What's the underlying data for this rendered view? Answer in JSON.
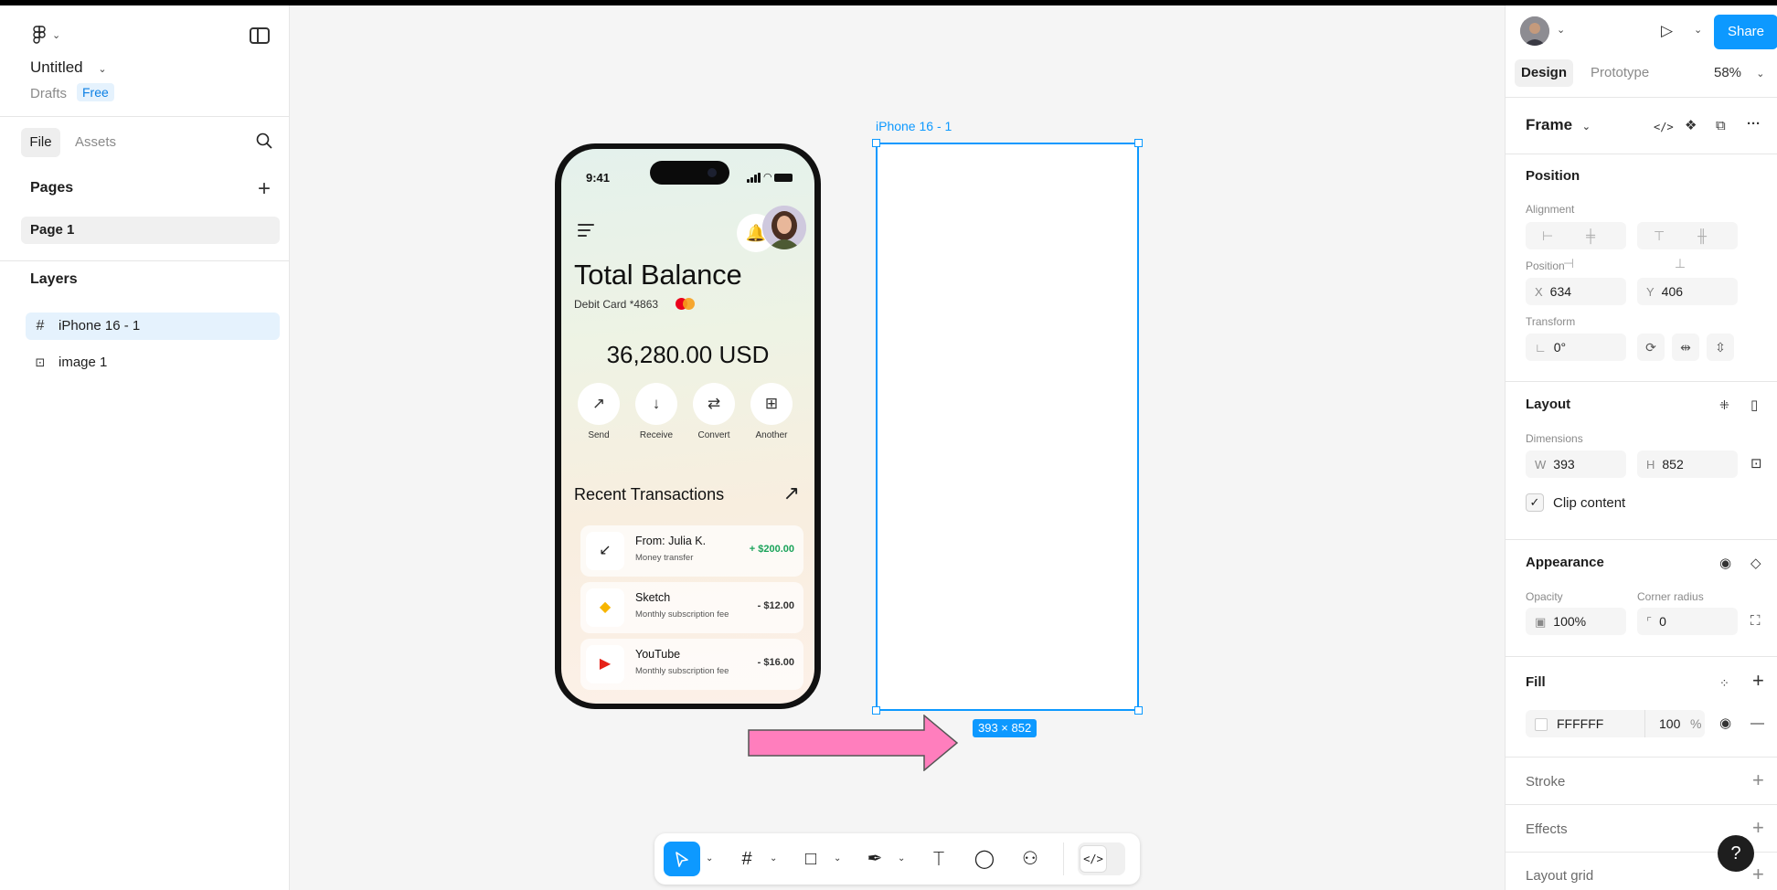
{
  "left_panel": {
    "file_name": "Untitled",
    "location": "Drafts",
    "plan_badge": "Free",
    "tabs": {
      "file": "File",
      "assets": "Assets"
    },
    "pages_title": "Pages",
    "pages": [
      {
        "label": "Page 1"
      }
    ],
    "layers_title": "Layers",
    "layers": [
      {
        "label": "iPhone 16 - 1",
        "icon": "frame-icon"
      },
      {
        "label": "image 1",
        "icon": "image-icon"
      }
    ]
  },
  "canvas": {
    "background": "#f5f5f5",
    "mockup": {
      "time": "9:41",
      "title": "Total Balance",
      "card": "Debit Card *4863",
      "balance": "36,280.00 USD",
      "actions": [
        {
          "label": "Send",
          "icon": "↗"
        },
        {
          "label": "Receive",
          "icon": "↓"
        },
        {
          "label": "Convert",
          "icon": "⇄"
        },
        {
          "label": "Another",
          "icon": "⊞"
        }
      ],
      "recent_title": "Recent Transactions",
      "transactions": [
        {
          "from_prefix": "From: ",
          "name": "Julia K.",
          "desc": "Money transfer",
          "amount": "+ $200.00",
          "icon": "↙"
        },
        {
          "name": "Sketch",
          "desc": "Monthly subscription fee",
          "amount": "- $12.00",
          "icon": "◆"
        },
        {
          "name": "YouTube",
          "desc": "Monthly subscription fee",
          "amount": "- $16.00",
          "icon": "▶"
        }
      ]
    },
    "frame": {
      "label": "iPhone 16 - 1",
      "size_badge": "393 × 852"
    },
    "selection_color": "#0d99ff",
    "arrow_color": "#ff7ebd"
  },
  "toolbar": {
    "tools": [
      {
        "name": "move-tool",
        "icon": "cursor-icon",
        "selected": true
      },
      {
        "name": "frame-tool",
        "icon": "hash-icon"
      },
      {
        "name": "shape-tool",
        "icon": "rectangle-icon"
      },
      {
        "name": "pen-tool",
        "icon": "pen-icon"
      },
      {
        "name": "text-tool",
        "icon": "text-icon"
      },
      {
        "name": "comment-tool",
        "icon": "comment-icon"
      },
      {
        "name": "actions-tool",
        "icon": "actions-icon"
      },
      {
        "name": "dev-mode-toggle",
        "icon": "code-icon"
      }
    ]
  },
  "right_panel": {
    "share": "Share",
    "tabs": {
      "design": "Design",
      "prototype": "Prototype"
    },
    "zoom": "58%",
    "frame_title": "Frame",
    "position": {
      "title": "Position",
      "alignment_label": "Alignment",
      "position_label": "Position",
      "x": "634",
      "y": "406",
      "transform_label": "Transform",
      "rotation": "0°"
    },
    "layout": {
      "title": "Layout",
      "dimensions_label": "Dimensions",
      "w": "393",
      "h": "852",
      "clip_content": "Clip content"
    },
    "appearance": {
      "title": "Appearance",
      "opacity_label": "Opacity",
      "opacity": "100%",
      "radius_label": "Corner radius",
      "radius": "0"
    },
    "fill": {
      "title": "Fill",
      "hex": "FFFFFF",
      "opacity": "100",
      "pct": "%"
    },
    "stroke": "Stroke",
    "effects": "Effects",
    "layout_grid": "Layout grid",
    "help": "?"
  }
}
